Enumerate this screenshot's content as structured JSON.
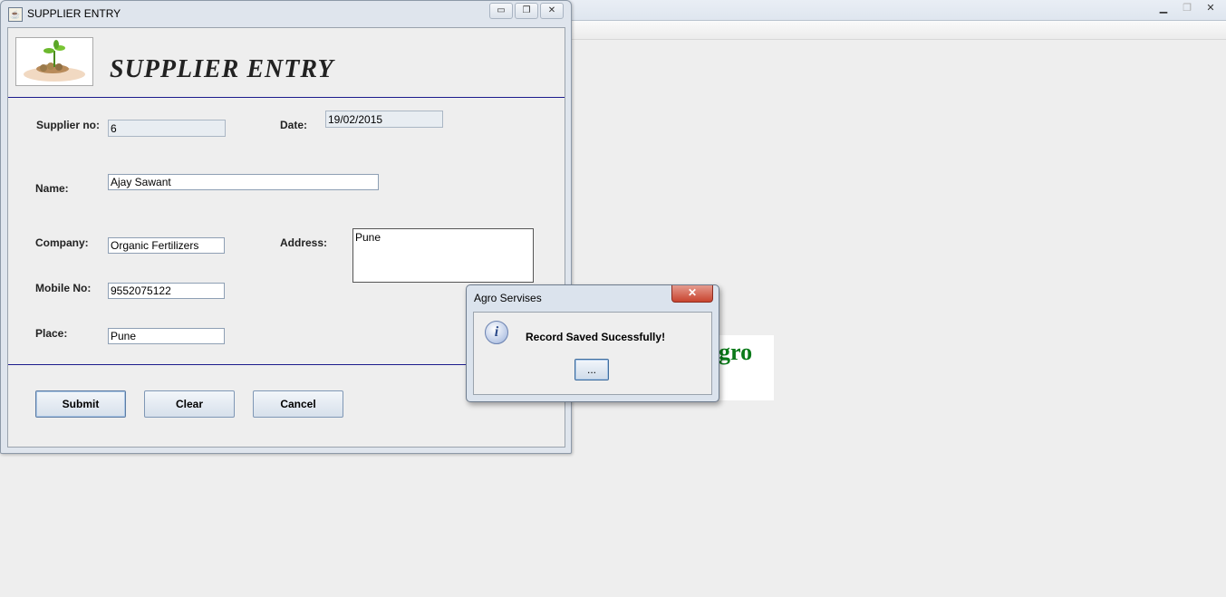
{
  "background_window": {
    "logo_text": "gro",
    "controls": {
      "minimize_icon": "minimize-icon",
      "maximize_icon": "maximize-icon",
      "close_icon": "close-icon"
    }
  },
  "frame": {
    "title": "SUPPLIER ENTRY",
    "heading": "SUPPLIER ENTRY",
    "controls": {
      "minimize": "▭",
      "restore": "❐",
      "close": "✕"
    }
  },
  "form": {
    "supplier_no_label": "Supplier no:",
    "supplier_no_value": "6",
    "date_label": "Date:",
    "date_value": "19/02/2015",
    "name_label": "Name:",
    "name_value": "Ajay Sawant",
    "company_label": "Company:",
    "company_value": "Organic Fertilizers",
    "address_label": "Address:",
    "address_value": "Pune",
    "mobile_label": "Mobile No:",
    "mobile_value": "9552075122",
    "place_label": "Place:",
    "place_value": "Pune"
  },
  "buttons": {
    "submit": "Submit",
    "clear": "Clear",
    "cancel": "Cancel"
  },
  "dialog": {
    "title": "Agro Servises",
    "message": "Record Saved Sucessfully!",
    "ok_label": "...",
    "close": "✕",
    "icon": "info-icon"
  }
}
